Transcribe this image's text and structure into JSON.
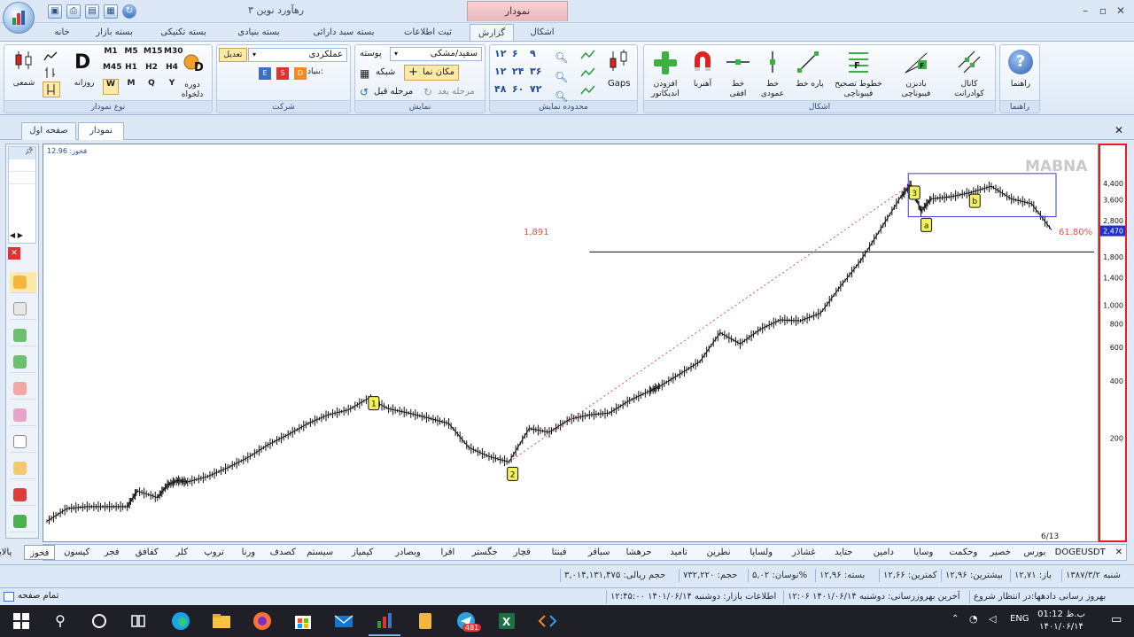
{
  "window": {
    "title": "رهآورد نوین ۳",
    "context_tab": "نمودار"
  },
  "ribbon_tabs": [
    {
      "label": "خانه"
    },
    {
      "label": "بسته بازار"
    },
    {
      "label": "بسته تکنیکی"
    },
    {
      "label": "بسته بنیادی"
    },
    {
      "label": "بسته سبد دارائی"
    },
    {
      "label": "ثبت اطلاعات"
    },
    {
      "label": "گزارش"
    },
    {
      "label": "اشکال"
    }
  ],
  "groups": {
    "chart_type": {
      "label": "نوع نمودار",
      "candle": "شمعی",
      "daily_letter": "D",
      "daily": "روزانه",
      "period": "دوره\nدلخواه",
      "periods_top": [
        "M1",
        "M5",
        "M15",
        "M30"
      ],
      "periods_mid": [
        "M45",
        "H1",
        "H2",
        "H4"
      ],
      "periods_bottom": [
        "W",
        "M",
        "Q",
        "Y"
      ]
    },
    "company": {
      "label": "شرکت",
      "symbol": "عملکردی",
      "adjust": "تعدیل",
      "fundamental": "بنیادی:"
    },
    "display": {
      "label": "نمایش",
      "theme": "سفید/مشکی",
      "skin": "پوسته",
      "cursor": "مکان نما",
      "grid": "شبکه",
      "prev": "مرحله قبل",
      "next": "مرحله بعد"
    },
    "range": {
      "label": "محدوده نمایش",
      "nums": [
        "۱۲",
        "۶",
        "۹",
        "۱۲",
        "۲۴",
        "۳۶",
        "۴۸",
        "۶۰",
        "۷۲"
      ],
      "gaps": "Gaps"
    },
    "shapes": {
      "label": "اشکال",
      "add_indicator": "افزودن\nاندیکاتور",
      "magnet": "آهنربا",
      "hline": "خط\nافقی",
      "vline": "خط\nعمودی",
      "segment": "پاره خط",
      "fib_retrace": "خطوط تصحیح\nفیبوناچی",
      "fib_fan": "بادبزن\nفیبوناچی",
      "channel": "کانال\nکوادرانت"
    },
    "help": {
      "label": "راهنما",
      "btn": "راهنما"
    }
  },
  "doc_tabs": [
    {
      "label": "صفحه اول"
    },
    {
      "label": "نمودار"
    }
  ],
  "chart": {
    "watermark": "MABNA",
    "top_label": "فخوز: 12.96",
    "fib_left": "1,891",
    "fib_right": "61.80%",
    "date_label": "6/13",
    "last_price": "2,470",
    "markers": [
      "1",
      "2",
      "3",
      "a",
      "b"
    ]
  },
  "chart_data": {
    "type": "line",
    "title": "",
    "xlabel": "",
    "ylabel": "",
    "yscale": "log",
    "ylim": [
      70,
      6000
    ],
    "y_ticks": [
      {
        "label": "4,400",
        "value": 4400
      },
      {
        "label": "3,600",
        "value": 3600
      },
      {
        "label": "2,800",
        "value": 2800
      },
      {
        "label": "1,800",
        "value": 1800
      },
      {
        "label": "1,400",
        "value": 1400
      },
      {
        "label": "1,000",
        "value": 1000
      },
      {
        "label": "800",
        "value": 800
      },
      {
        "label": "600",
        "value": 600
      },
      {
        "label": "400",
        "value": 400
      },
      {
        "label": "200",
        "value": 200
      }
    ],
    "series": [
      {
        "x": [
          0,
          2,
          4,
          6,
          8,
          9,
          11,
          12,
          13,
          14,
          16,
          18,
          20,
          22,
          24,
          26,
          28,
          30,
          32,
          34,
          36,
          38,
          40,
          42,
          44,
          46,
          48,
          50,
          52,
          54,
          56,
          58,
          60,
          61,
          63,
          65,
          67,
          69,
          71,
          73,
          75,
          77,
          79,
          81,
          83,
          85,
          86,
          87,
          88,
          90,
          92,
          94,
          96,
          98,
          100
        ],
        "values": [
          72,
          84,
          86,
          86,
          86,
          104,
          96,
          112,
          118,
          116,
          124,
          138,
          156,
          182,
          206,
          236,
          262,
          278,
          320,
          282,
          268,
          252,
          236,
          176,
          158,
          148,
          222,
          212,
          248,
          262,
          268,
          312,
          350,
          370,
          430,
          500,
          710,
          620,
          740,
          830,
          820,
          900,
          1250,
          1700,
          2500,
          3700,
          4300,
          3100,
          3600,
          3700,
          3900,
          4200,
          3600,
          3400,
          2470
        ]
      }
    ],
    "fib_level": {
      "value": 1891,
      "label": "61.80%"
    },
    "y_range_labels": [
      "4,400",
      "200"
    ]
  },
  "symbols": {
    "items": [
      "DOGEUSDT",
      "بورس",
      "خصیر",
      "وحکمت",
      "وسایا",
      "دامین",
      "حتاید",
      "غشاذر",
      "ولساپا",
      "نطرین",
      "تامید",
      "حرهشا",
      "سباقر",
      "فبنتا",
      "قچار",
      "خگستر",
      "افرا",
      "وبصادر",
      "کیمیاز",
      "سیستم",
      "کصدف",
      "ورنا",
      "تروپ",
      "کلر",
      "کفافق",
      "فجر",
      "کیسون",
      "فخوز",
      "پالایش"
    ],
    "selected": "فخوز"
  },
  "status": {
    "date": "شنبه ۱۳۸۷/۳/۲",
    "open": "باز: ۱۲,۷۱",
    "high": "بیشترین: ۱۲,۹۶",
    "low": "کمترین: ۱۲,۶۶",
    "close": "بسته: ۱۲,۹۶",
    "change": "نوسان: ۵,۰۲%",
    "volume": "حجم: ۷۳۲,۲۲۰",
    "value": "حجم ریالی: ۳,۰۱۴,۱۳۱,۴۷۵"
  },
  "status2": {
    "update": "بهروز رسانی دادهها:در انتظار شروع",
    "last_update": "آخرین بهروزرسانی: دوشنبه ۱۴۰۱/۰۶/۱۴ ۱۲:۰۶",
    "market_info": "اطلاعات بازار: دوشنبه ۱۴۰۱/۰۶/۱۴ ۱۲:۴۵:۰۰",
    "fullscreen": "تمام صفحه"
  },
  "taskbar": {
    "time": "ب.ظ 01:12",
    "date": "۱۴۰۱/۰۶/۱۴",
    "lang": "ENG",
    "telegram_badge": "481"
  }
}
